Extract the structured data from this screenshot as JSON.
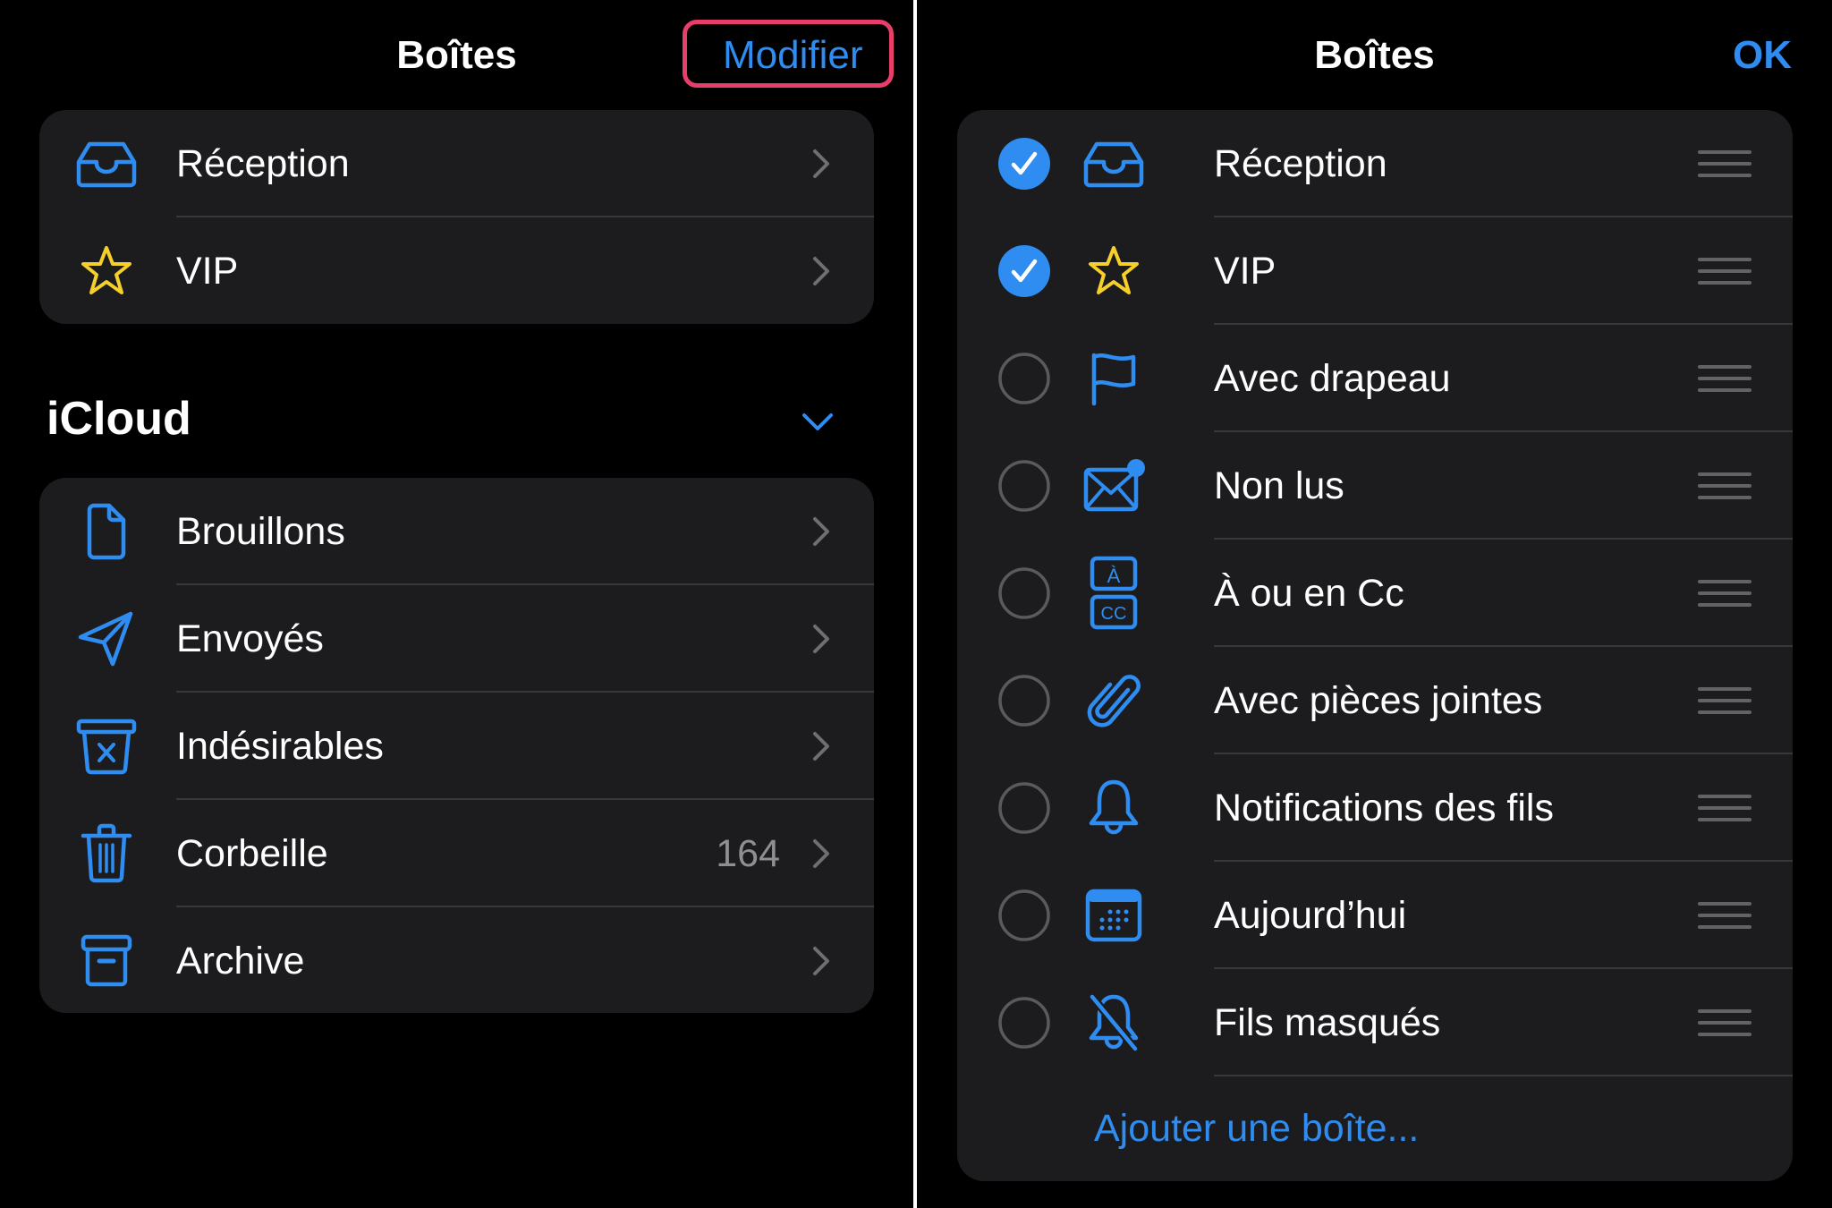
{
  "colors": {
    "accent": "#2f8cf0",
    "vip_star": "#f5cf2a",
    "highlight": "#e83e6c",
    "card_bg": "#1c1c1e",
    "secondary_text": "#8e8e93"
  },
  "left": {
    "title": "Boîtes",
    "edit_button": "Modifier",
    "favorites": [
      {
        "label": "Réception",
        "icon": "inbox-icon"
      },
      {
        "label": "VIP",
        "icon": "star-icon"
      }
    ],
    "account_section": {
      "title": "iCloud",
      "expanded": true,
      "items": [
        {
          "label": "Brouillons",
          "icon": "document-icon",
          "count": null
        },
        {
          "label": "Envoyés",
          "icon": "paperplane-icon",
          "count": null
        },
        {
          "label": "Indésirables",
          "icon": "junk-icon",
          "count": null
        },
        {
          "label": "Corbeille",
          "icon": "trash-icon",
          "count": "164"
        },
        {
          "label": "Archive",
          "icon": "archive-icon",
          "count": null
        }
      ]
    }
  },
  "right": {
    "title": "Boîtes",
    "done_button": "OK",
    "items": [
      {
        "label": "Réception",
        "icon": "inbox-icon",
        "checked": true
      },
      {
        "label": "VIP",
        "icon": "star-icon",
        "checked": true
      },
      {
        "label": "Avec drapeau",
        "icon": "flag-icon",
        "checked": false
      },
      {
        "label": "Non lus",
        "icon": "unread-envelope-icon",
        "checked": false
      },
      {
        "label": "À ou en Cc",
        "icon": "to-cc-icon",
        "checked": false
      },
      {
        "label": "Avec pièces jointes",
        "icon": "paperclip-icon",
        "checked": false
      },
      {
        "label": "Notifications des fils",
        "icon": "bell-icon",
        "checked": false
      },
      {
        "label": "Aujourd’hui",
        "icon": "calendar-icon",
        "checked": false
      },
      {
        "label": "Fils masqués",
        "icon": "bell-slash-icon",
        "checked": false
      }
    ],
    "add_mailbox": "Ajouter une boîte..."
  }
}
